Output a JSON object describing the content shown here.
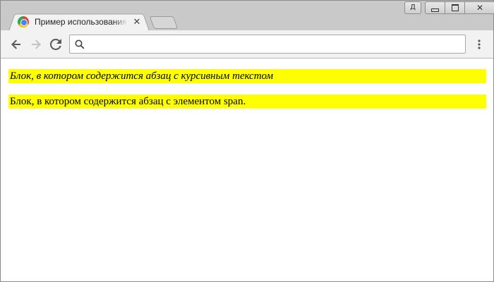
{
  "window": {
    "user_button_label": "Д",
    "controls": {
      "close_glyph": "✕"
    }
  },
  "tab": {
    "title": "Пример использования jQuery",
    "close_glyph": "✕"
  },
  "toolbar": {
    "icons": [
      "back-arrow-icon",
      "forward-arrow-icon",
      "reload-icon",
      "search-icon",
      "menu-icon"
    ]
  },
  "omnibox": {
    "value": "",
    "placeholder": ""
  },
  "page": {
    "block1_text": "Блок, в котором содержится абзац с курсивным текстом",
    "block2_text": "Блок, в котором содержится абзац с элементом span.",
    "block_color": "#ffff00"
  }
}
